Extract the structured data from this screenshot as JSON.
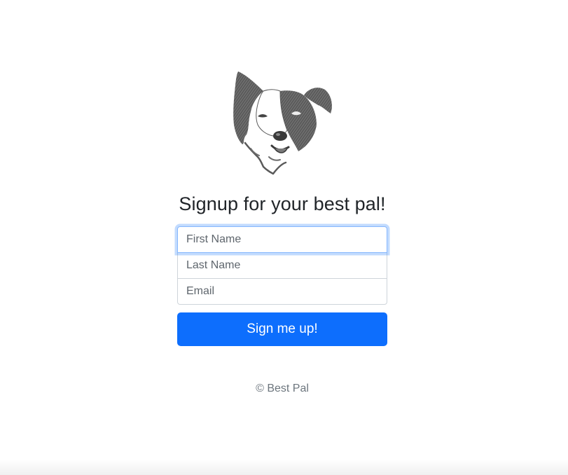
{
  "logo": {
    "icon": "border-collie-dog-head-icon"
  },
  "headline": "Signup for your best pal!",
  "form": {
    "first_name": {
      "value": "",
      "placeholder": "First Name"
    },
    "last_name": {
      "value": "",
      "placeholder": "Last Name"
    },
    "email": {
      "value": "",
      "placeholder": "Email"
    },
    "submit_label": "Sign me up!"
  },
  "footer": "© Best Pal",
  "colors": {
    "primary": "#0d6efd",
    "focus_ring": "#86b7fe",
    "text": "#212529",
    "muted": "#6c757d"
  }
}
